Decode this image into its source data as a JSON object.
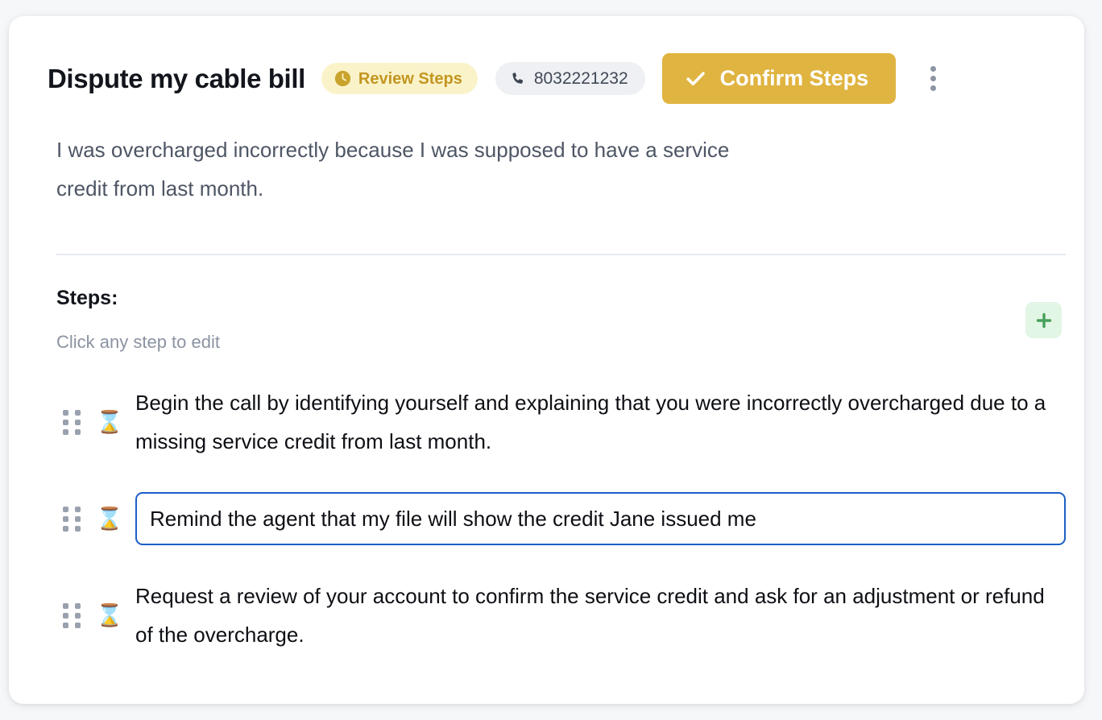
{
  "colors": {
    "page_background": "#f6f7f9",
    "card_background": "#ffffff",
    "accent_amber": "#e0b441",
    "badge_review_bg": "#faf3c9",
    "badge_review_text": "#c39621",
    "badge_phone_bg": "#eef0f3",
    "badge_phone_text": "#414856",
    "add_button_bg": "#e2f6e5",
    "add_button_icon": "#48a05d",
    "input_focus_border": "#1b5fc7",
    "muted_text": "#8b93a2",
    "body_text": "#4e5665"
  },
  "header": {
    "title": "Dispute my cable bill",
    "review_badge": {
      "label": "Review Steps",
      "icon": "clock-icon"
    },
    "phone_badge": {
      "number": "8032221232",
      "icon": "phone-icon"
    },
    "confirm_button": {
      "label": "Confirm Steps",
      "icon": "check-icon"
    },
    "menu_button": {
      "icon": "kebab-menu-icon"
    }
  },
  "description": "I was overcharged incorrectly because I was supposed to have a service credit from last month.",
  "steps_section": {
    "heading": "Steps:",
    "subheading": "Click any step to edit",
    "add_button": {
      "icon": "plus-icon"
    },
    "steps": [
      {
        "status_icon": "hourglass-icon",
        "emoji": "⌛",
        "text": "Begin the call by identifying yourself and explaining that you were incorrectly overcharged due to a missing service credit from last month.",
        "editing": false
      },
      {
        "status_icon": "hourglass-icon",
        "emoji": "⌛",
        "text": "Remind the agent that my file will show the credit Jane issued me",
        "editing": true
      },
      {
        "status_icon": "hourglass-icon",
        "emoji": "⌛",
        "text": "Request a review of your account to confirm the service credit and ask for an adjustment or refund of the overcharge.",
        "editing": false
      }
    ]
  }
}
